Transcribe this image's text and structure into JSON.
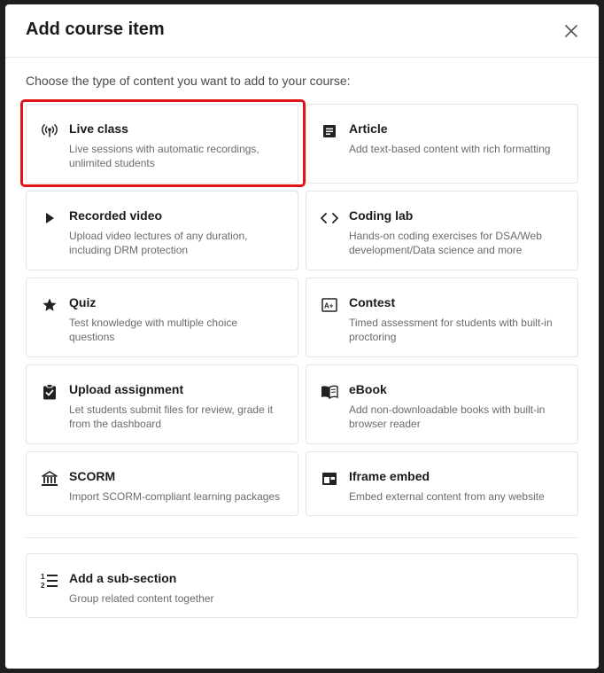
{
  "modal": {
    "title": "Add course item",
    "subtitle": "Choose the type of content you want to add to your course:",
    "close_icon": "close-icon"
  },
  "items": [
    {
      "title": "Live class",
      "desc": "Live sessions with automatic recordings, unlimited students",
      "icon": "broadcast-icon"
    },
    {
      "title": "Article",
      "desc": "Add text-based content with rich formatting",
      "icon": "article-icon"
    },
    {
      "title": "Recorded video",
      "desc": "Upload video lectures of any duration, including DRM protection",
      "icon": "play-icon"
    },
    {
      "title": "Coding lab",
      "desc": "Hands-on coding exercises for DSA/Web development/Data science and more",
      "icon": "code-icon"
    },
    {
      "title": "Quiz",
      "desc": "Test knowledge with multiple choice questions",
      "icon": "star-icon"
    },
    {
      "title": "Contest",
      "desc": "Timed assessment for students with built-in proctoring",
      "icon": "grade-icon"
    },
    {
      "title": "Upload assignment",
      "desc": "Let students submit files for review, grade it from the dashboard",
      "icon": "clipboard-check-icon"
    },
    {
      "title": "eBook",
      "desc": "Add non-downloadable books with built-in browser reader",
      "icon": "book-icon"
    },
    {
      "title": "SCORM",
      "desc": "Import SCORM-compliant learning packages",
      "icon": "institution-icon"
    },
    {
      "title": "Iframe embed",
      "desc": "Embed external content from any website",
      "icon": "embed-icon"
    }
  ],
  "subsection": {
    "title": "Add a sub-section",
    "desc": "Group related content together",
    "icon": "numbered-list-icon"
  },
  "colors": {
    "highlight": "#e01515",
    "border": "#e3e3e3",
    "text": "#1a1a1a",
    "muted": "#6b6b6b"
  }
}
